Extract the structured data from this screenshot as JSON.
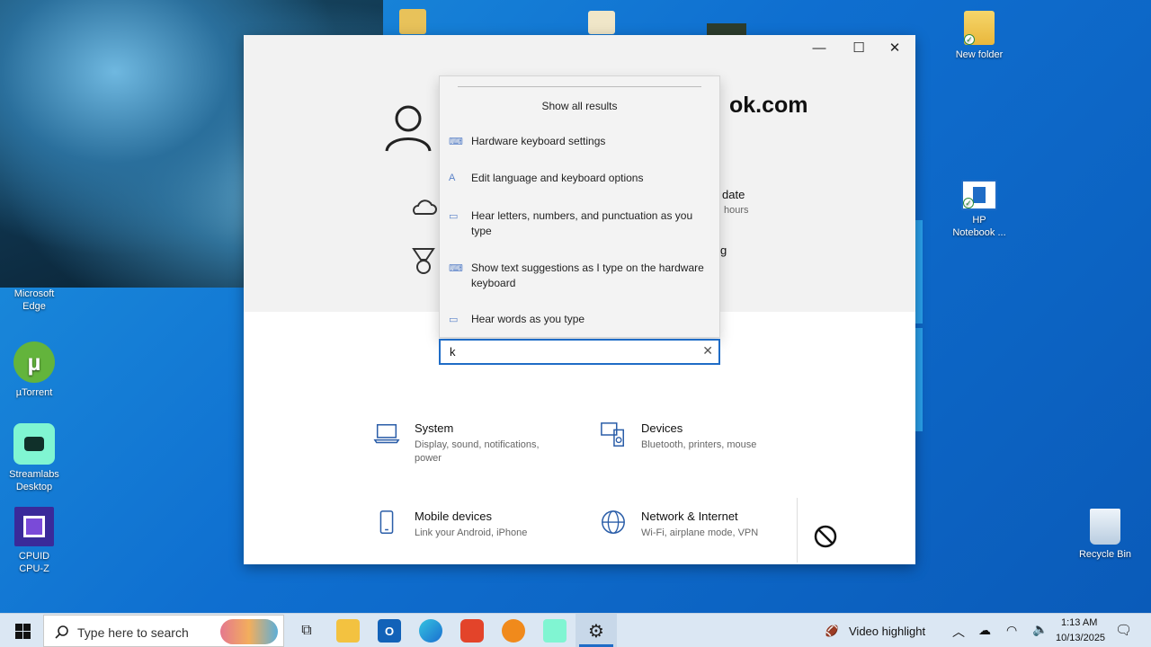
{
  "desktop": {
    "icons": [
      {
        "label": "New folder"
      },
      {
        "label": "HP\nNotebook ..."
      },
      {
        "label": "Microsoft\nEdge"
      },
      {
        "label": "µTorrent"
      },
      {
        "label": "Streamlabs\nDesktop"
      },
      {
        "label": "CPUID\nCPU-Z"
      },
      {
        "label": "Recycle Bin"
      }
    ]
  },
  "settings": {
    "title_partial": "ok.com",
    "sidebar_texts": [
      "date",
      "hours",
      "g"
    ],
    "categories": [
      {
        "name": "System",
        "desc": "Display, sound, notifications, power"
      },
      {
        "name": "Devices",
        "desc": "Bluetooth, printers, mouse"
      },
      {
        "name": "Mobile devices",
        "desc": "Link your Android, iPhone"
      },
      {
        "name": "Network & Internet",
        "desc": "Wi-Fi, airplane mode, VPN"
      }
    ],
    "search": {
      "value": "k",
      "results": [
        "Hardware keyboard settings",
        "Edit language and keyboard options",
        "Hear letters, numbers, and punctuation as you type",
        "Show text suggestions as I type on the hardware keyboard",
        "Hear words as you type"
      ],
      "show_all": "Show all results"
    }
  },
  "taskbar": {
    "search_placeholder": "Type here to search",
    "video_highlight": "Video highlight",
    "time": "1:13 AM",
    "date": "10/13/2025"
  },
  "colors": {
    "accent": "#1f6cc6",
    "desktop": "#1479d4"
  }
}
